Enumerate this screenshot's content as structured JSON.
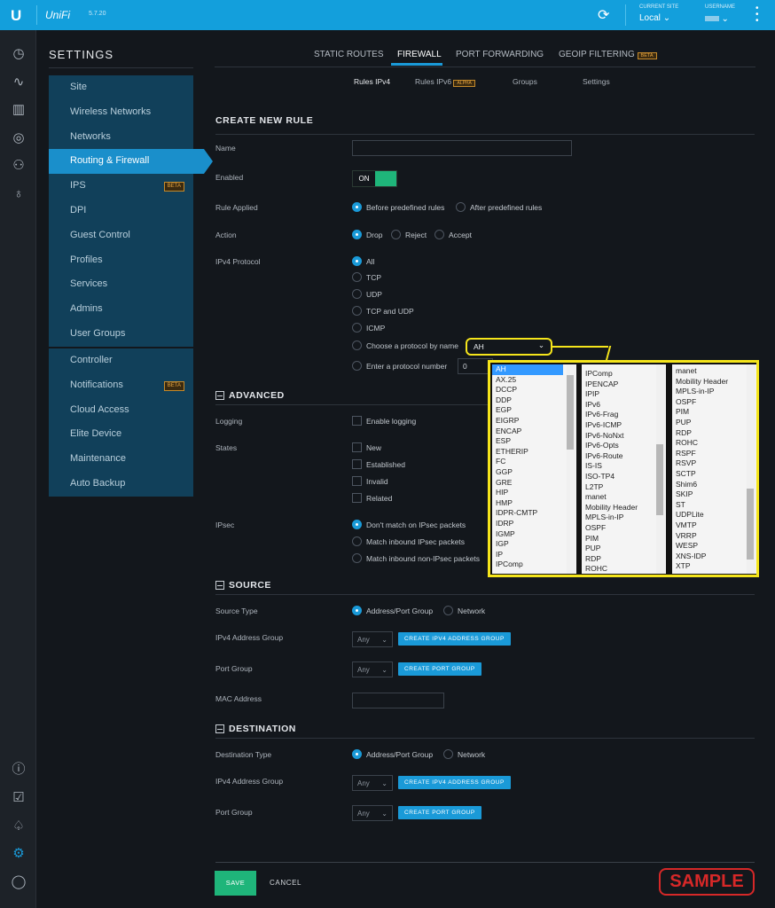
{
  "topbar": {
    "version": "5.7.20",
    "logo_text": "UniFi",
    "current_site_label": "CURRENT SITE",
    "current_site": "Local",
    "username_label": "USERNAME"
  },
  "sidebar": {
    "title": "SETTINGS",
    "group1": [
      {
        "label": "Site"
      },
      {
        "label": "Wireless Networks"
      },
      {
        "label": "Networks"
      },
      {
        "label": "Routing & Firewall",
        "active": true
      },
      {
        "label": "IPS",
        "badge": "BETA"
      },
      {
        "label": "DPI"
      },
      {
        "label": "Guest Control"
      },
      {
        "label": "Profiles"
      },
      {
        "label": "Services"
      },
      {
        "label": "Admins"
      },
      {
        "label": "User Groups"
      }
    ],
    "group2": [
      {
        "label": "Controller"
      },
      {
        "label": "Notifications",
        "badge": "BETA"
      },
      {
        "label": "Cloud Access"
      },
      {
        "label": "Elite Device"
      },
      {
        "label": "Maintenance"
      },
      {
        "label": "Auto Backup"
      }
    ]
  },
  "tabs": [
    {
      "label": "STATIC ROUTES"
    },
    {
      "label": "FIREWALL",
      "active": true
    },
    {
      "label": "PORT FORWARDING"
    },
    {
      "label": "GEOIP FILTERING",
      "badge": "BETA"
    }
  ],
  "subtabs": [
    {
      "label": "Rules IPv4",
      "active": true
    },
    {
      "label": "Rules IPv6",
      "badge": "ALPHA"
    },
    {
      "label": "Groups"
    },
    {
      "label": "Settings"
    }
  ],
  "form": {
    "title": "CREATE NEW RULE",
    "name_label": "Name",
    "name_value": "",
    "enabled_label": "Enabled",
    "enabled_value": "ON",
    "rule_applied_label": "Rule Applied",
    "rule_applied_options": [
      "Before predefined rules",
      "After predefined rules"
    ],
    "action_label": "Action",
    "action_options": [
      "Drop",
      "Reject",
      "Accept"
    ],
    "protocol_label": "IPv4 Protocol",
    "protocol_options": [
      "All",
      "TCP",
      "UDP",
      "TCP and UDP",
      "ICMP",
      "Choose a protocol by name",
      "Enter a protocol number"
    ],
    "protocol_name_value": "AH",
    "protocol_number_value": "0"
  },
  "advanced": {
    "title": "ADVANCED",
    "logging_label": "Logging",
    "logging_option": "Enable logging",
    "states_label": "States",
    "states": [
      "New",
      "Established",
      "Invalid",
      "Related"
    ],
    "ipsec_label": "IPsec",
    "ipsec_options": [
      "Don't match on IPsec packets",
      "Match inbound IPsec packets",
      "Match inbound non-IPsec packets"
    ]
  },
  "source": {
    "title": "SOURCE",
    "type_label": "Source Type",
    "type_options": [
      "Address/Port Group",
      "Network"
    ],
    "addr_group_label": "IPv4 Address Group",
    "addr_group_value": "Any",
    "create_addr_group": "CREATE IPV4 ADDRESS GROUP",
    "port_group_label": "Port Group",
    "port_group_value": "Any",
    "create_port_group": "CREATE PORT GROUP",
    "mac_label": "MAC Address",
    "mac_value": ""
  },
  "destination": {
    "title": "DESTINATION",
    "type_label": "Destination Type",
    "type_options": [
      "Address/Port Group",
      "Network"
    ],
    "addr_group_label": "IPv4 Address Group",
    "addr_group_value": "Any",
    "create_addr_group": "CREATE IPV4 ADDRESS GROUP",
    "port_group_label": "Port Group",
    "port_group_value": "Any",
    "create_port_group": "CREATE PORT GROUP"
  },
  "footer": {
    "save": "SAVE",
    "cancel": "CANCEL"
  },
  "watermark": "SAMPLE",
  "dropdown_lists": [
    [
      "AH",
      "AX.25",
      "DCCP",
      "DDP",
      "EGP",
      "EIGRP",
      "ENCAP",
      "ESP",
      "ETHERIP",
      "FC",
      "GGP",
      "GRE",
      "HIP",
      "HMP",
      "IDPR-CMTP",
      "IDRP",
      "IGMP",
      "IGP",
      "IP",
      "IPComp"
    ],
    [
      "IPComp",
      "IPENCAP",
      "IPIP",
      "IPv6",
      "IPv6-Frag",
      "IPv6-ICMP",
      "IPv6-NoNxt",
      "IPv6-Opts",
      "IPv6-Route",
      "IS-IS",
      "ISO-TP4",
      "L2TP",
      "manet",
      "Mobility Header",
      "MPLS-in-IP",
      "OSPF",
      "PIM",
      "PUP",
      "RDP",
      "ROHC"
    ],
    [
      "manet",
      "Mobility Header",
      "MPLS-in-IP",
      "OSPF",
      "PIM",
      "PUP",
      "RDP",
      "ROHC",
      "RSPF",
      "RSVP",
      "SCTP",
      "Shim6",
      "SKIP",
      "ST",
      "UDPLite",
      "VMTP",
      "VRRP",
      "WESP",
      "XNS-IDP",
      "XTP"
    ]
  ],
  "colors": {
    "topbar": "#139fdc",
    "accent": "#1a9ad8",
    "save": "#1fb57a",
    "toggle_on": "#1fb57a",
    "highlight": "#f5e51b",
    "watermark": "#d62828"
  }
}
